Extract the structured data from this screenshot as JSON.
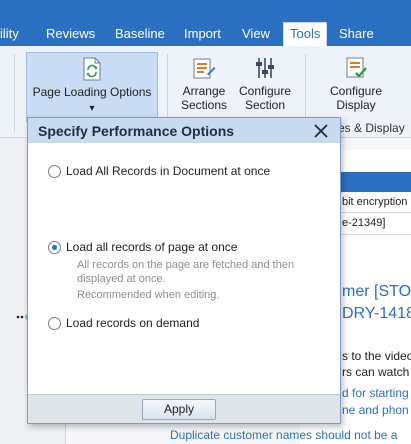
{
  "tabs": [
    {
      "label": "ility"
    },
    {
      "label": "Reviews"
    },
    {
      "label": "Baseline"
    },
    {
      "label": "Import"
    },
    {
      "label": "View"
    },
    {
      "label": "Tools",
      "active": true
    },
    {
      "label": "Share"
    }
  ],
  "ribbon": {
    "page_loading_options": {
      "label": "Page Loading Options",
      "dropdown": "▾"
    },
    "arrange_sections": {
      "line1": "Arrange",
      "line2": "Sections"
    },
    "configure_section": {
      "line1": "Configure",
      "line2": "Section"
    },
    "configure_display": {
      "line1": "Configure",
      "line2": "Display"
    },
    "group_label": "es & Display"
  },
  "document": {
    "line1": "bit encryption",
    "line2": "e-21349]",
    "heading1": "mer [STO",
    "heading2": "DRY-1418",
    "para1": "s to the video",
    "para2": "rs can watch",
    "para3": "d for starting",
    "para4": "ne and phon",
    "para5": "Duplicate customer names should not be a"
  },
  "dialog": {
    "title": "Specify Performance Options",
    "options": [
      {
        "label": "Load All Records in Document at once",
        "selected": false
      },
      {
        "label": "Load all records of page at once",
        "selected": true
      },
      {
        "label": "Load records on demand",
        "selected": false
      }
    ],
    "description": [
      "All records on the page are fetched and then",
      "displayed at once.",
      "Recommended when editing."
    ],
    "apply_label": "Apply"
  },
  "colors": {
    "accent": "#2b6fc0",
    "title_bar": "#c8daf0",
    "link": "#2b6fc0",
    "description_text": "#8e8e8e"
  }
}
